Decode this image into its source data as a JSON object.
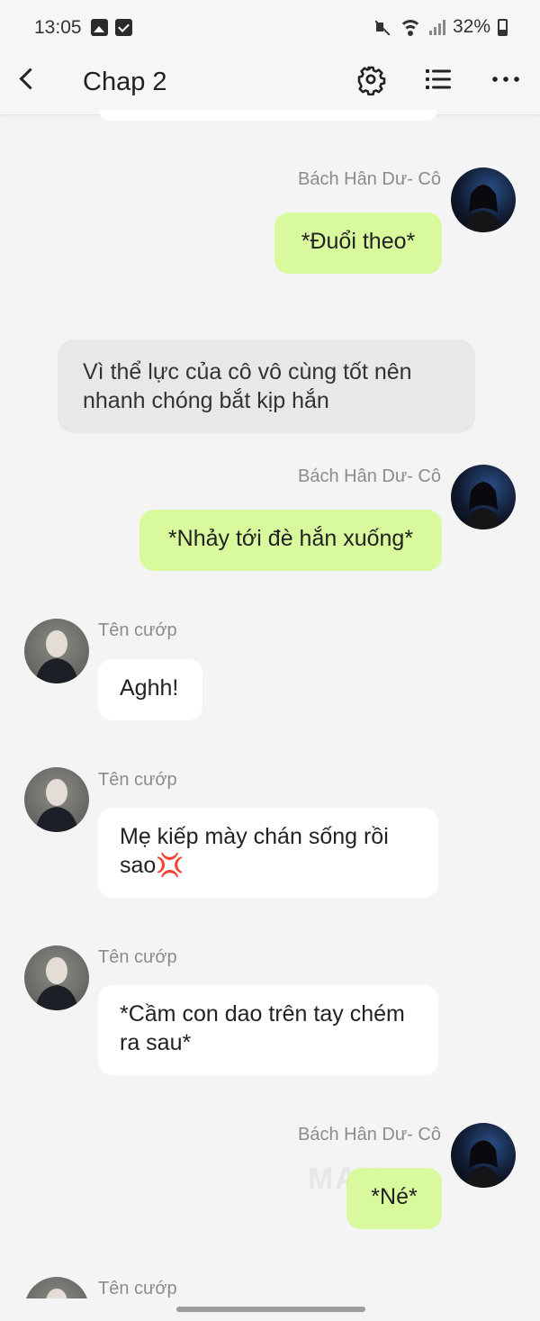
{
  "status_bar": {
    "time": "13:05",
    "battery": "32%",
    "icons": [
      "photo-icon",
      "checkbox-icon",
      "mute-icon",
      "wifi-icon",
      "signal-icon",
      "battery-icon"
    ]
  },
  "header": {
    "title": "Chap 2",
    "icons": [
      "back-icon",
      "gear-icon",
      "list-icon",
      "more-icon"
    ]
  },
  "messages": [
    {
      "type": "outgoing",
      "sender": "Bách Hân Dư- Cô",
      "text": "*Đuổi theo*"
    },
    {
      "type": "narration",
      "text": "Vì thể lực của cô vô cùng tốt nên nhanh chóng bắt kịp hắn"
    },
    {
      "type": "outgoing",
      "sender": "Bách Hân Dư- Cô",
      "text": "*Nhảy tới đè hắn xuống*"
    },
    {
      "type": "incoming",
      "sender": "Tên cướp",
      "text": "Aghh!"
    },
    {
      "type": "incoming",
      "sender": "Tên cướp",
      "text": "Mẹ kiếp mày chán sống rồi sao💢"
    },
    {
      "type": "incoming",
      "sender": "Tên cướp",
      "text": "*Cầm con dao trên tay chém ra sau*"
    },
    {
      "type": "outgoing",
      "sender": "Bách Hân Dư- Cô",
      "text": "*Né*"
    },
    {
      "type": "incoming",
      "sender": "Tên cướp",
      "text": ""
    }
  ],
  "watermark": "MAN",
  "colors": {
    "background": "#f4f4f5",
    "outgoing_bubble": "#d9f99d",
    "incoming_bubble": "#ffffff",
    "narration_bubble": "#e8e8ea",
    "sender_name": "#8c8c8f"
  }
}
